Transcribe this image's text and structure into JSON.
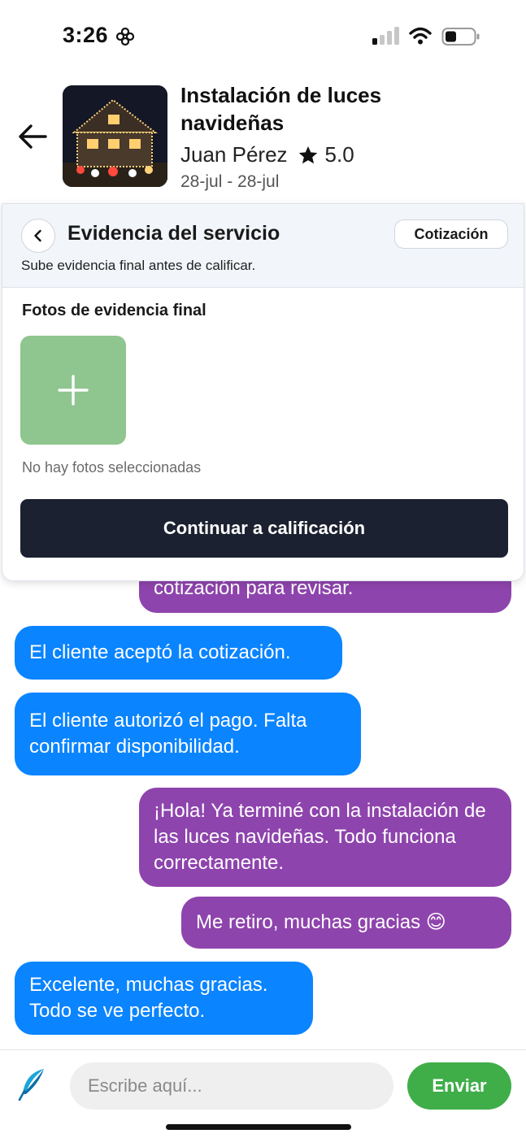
{
  "status_bar": {
    "time": "3:26",
    "icons": [
      "focus-flower-icon",
      "signal-icon",
      "wifi-icon",
      "battery-icon"
    ]
  },
  "header": {
    "title": "Instalación de luces navideñas",
    "provider_name": "Juan Pérez",
    "rating": "5.0",
    "date_range": "28-jul - 28-jul",
    "icons": [
      "back-arrow-icon",
      "star-icon"
    ]
  },
  "panel": {
    "title": "Evidencia del servicio",
    "subtitle": "Sube evidencia final antes de calificar.",
    "quote_button": "Cotización",
    "photos_section_title": "Fotos de evidencia final",
    "no_photos_text": "No hay fotos seleccionadas",
    "continue_button": "Continuar a calificación",
    "icons": [
      "chevron-left-icon",
      "plus-icon"
    ]
  },
  "messages": [
    {
      "direction": "out",
      "text": "cotización para revisar."
    },
    {
      "direction": "in",
      "text": "El cliente aceptó la cotización."
    },
    {
      "direction": "in",
      "text": "El cliente autorizó el pago. Falta confirmar disponibilidad."
    },
    {
      "direction": "out",
      "text": "¡Hola! Ya terminé con la instalación de las luces navideñas. Todo funciona correctamente."
    },
    {
      "direction": "out",
      "text": "Me retiro, muchas gracias 😊"
    },
    {
      "direction": "in",
      "text": "Excelente, muchas gracias. Todo se ve perfecto."
    }
  ],
  "input_bar": {
    "placeholder": "Escribe aquí...",
    "send_label": "Enviar",
    "icons": [
      "feather-icon"
    ]
  },
  "colors": {
    "outgoing_bubble": "#8e44ad",
    "incoming_bubble": "#0a84ff",
    "send_button": "#3fae49",
    "continue_button": "#1b2130",
    "add_photo_tile": "#8fc58e"
  }
}
